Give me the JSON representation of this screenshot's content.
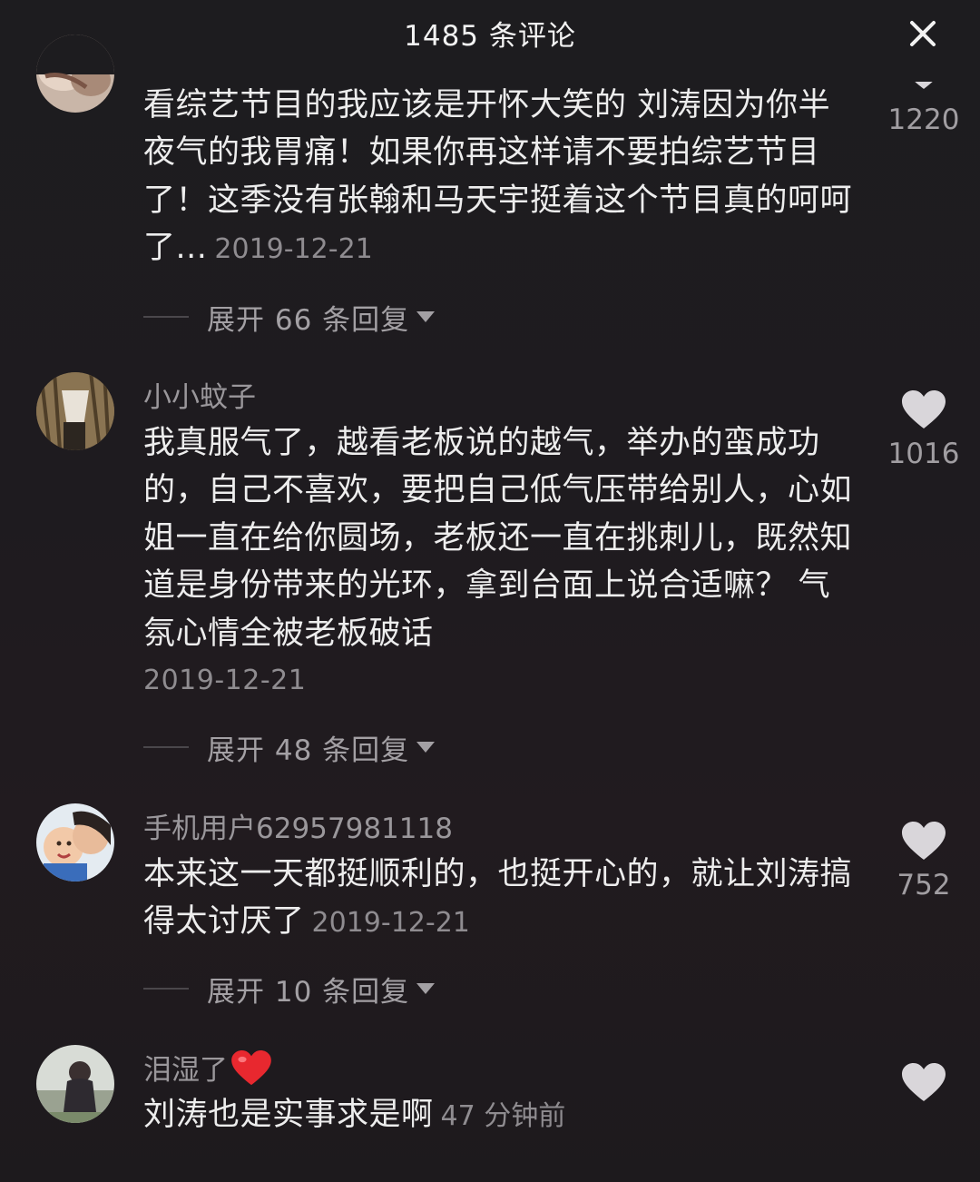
{
  "header": {
    "title": "1485 条评论"
  },
  "comments": [
    {
      "username": "",
      "text": "看综艺节目的我应该是开怀大笑的 刘涛因为你半夜气的我胃痛！如果你再这样请不要拍综艺节目了！这季没有张翰和马天宇挺着这个节目真的呵呵了...",
      "timestamp": "2019-12-21",
      "likes": "1220",
      "replies_label": "展开 66 条回复"
    },
    {
      "username": "小小蚊子",
      "text": "我真服气了，越看老板说的越气，举办的蛮成功的，自己不喜欢，要把自己低气压带给别人，心如姐一直在给你圆场，老板还一直在挑刺儿，既然知道是身份带来的光环，拿到台面上说合适嘛？ 气氛心情全被老板破话",
      "timestamp": "2019-12-21",
      "likes": "1016",
      "replies_label": "展开 48 条回复"
    },
    {
      "username": "手机用户62957981118",
      "text": "本来这一天都挺顺利的，也挺开心的，就让刘涛搞得太讨厌了",
      "timestamp": "2019-12-21",
      "likes": "752",
      "replies_label": "展开 10 条回复"
    },
    {
      "username": "泪湿了",
      "text": "刘涛也是实事求是啊",
      "timestamp": "47 分钟前",
      "likes": "",
      "replies_label": ""
    }
  ],
  "icons": {
    "close": "close-icon",
    "like": "heart-icon",
    "caret": "caret-down-icon",
    "username_emoji": "red-heart-emoji"
  },
  "colors": {
    "background": "#1c1a1d",
    "text_primary": "#ededed",
    "text_secondary": "#9a979b",
    "heart_icon": "#d9d6da",
    "emoji_heart": "#e8282f"
  }
}
